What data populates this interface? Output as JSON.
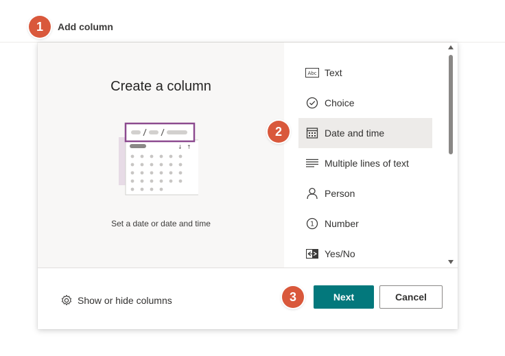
{
  "header": {
    "step": "1",
    "add_column_label": "Add column"
  },
  "dialog": {
    "title": "Create a column",
    "description": "Set a date or date and time",
    "types": [
      {
        "label": "Text",
        "icon": "text-abc-icon",
        "selected": false
      },
      {
        "label": "Choice",
        "icon": "choice-check-icon",
        "selected": false
      },
      {
        "label": "Date and time",
        "icon": "calendar-icon",
        "selected": true
      },
      {
        "label": "Multiple lines of text",
        "icon": "multiline-text-icon",
        "selected": false
      },
      {
        "label": "Person",
        "icon": "person-icon",
        "selected": false
      },
      {
        "label": "Number",
        "icon": "number-icon",
        "selected": false
      },
      {
        "label": "Yes/No",
        "icon": "yes-no-icon",
        "selected": false
      }
    ],
    "text_icon_label": "Abc",
    "number_icon_label": "1",
    "step_select": "2",
    "step_next": "3"
  },
  "footer": {
    "show_hide_label": "Show or hide columns",
    "next_label": "Next",
    "cancel_label": "Cancel"
  },
  "colors": {
    "step_badge": "#d9583b",
    "next_button": "#03787c",
    "selected_item": "#edebe9",
    "illustration_border": "#8c4a8f",
    "left_pane_bg": "#f8f7f6"
  }
}
